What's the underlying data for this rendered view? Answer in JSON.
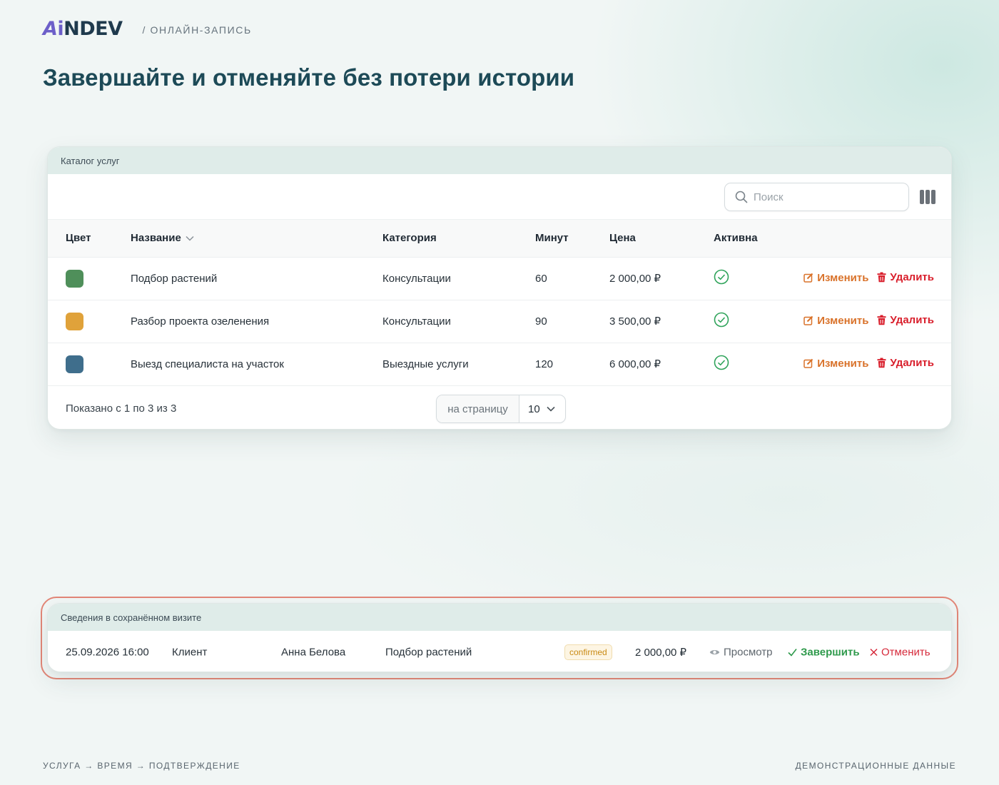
{
  "header": {
    "logo_a": "A",
    "logo_i": "i",
    "logo_rest": "NDEV",
    "crumb": "/ ОНЛАЙН-ЗАПИСЬ"
  },
  "page_title": "Завершайте и отменяйте без потери истории",
  "catalog": {
    "title": "Каталог услуг",
    "search_placeholder": "Поиск",
    "columns": {
      "color": "Цвет",
      "name": "Название",
      "category": "Категория",
      "minutes": "Минут",
      "price": "Цена",
      "active": "Активна"
    },
    "actions": {
      "edit": "Изменить",
      "delete": "Удалить"
    },
    "rows": [
      {
        "color": "#4f8f5a",
        "name": "Подбор растений",
        "category": "Консультации",
        "minutes": "60",
        "price": "2 000,00 ₽",
        "active": true
      },
      {
        "color": "#e0a23a",
        "name": "Разбор проекта озеленения",
        "category": "Консультации",
        "minutes": "90",
        "price": "3 500,00 ₽",
        "active": true
      },
      {
        "color": "#3f6e8c",
        "name": "Выезд специалиста на участок",
        "category": "Выездные услуги",
        "minutes": "120",
        "price": "6 000,00 ₽",
        "active": true
      }
    ],
    "footer": {
      "shown": "Показано с 1 по 3 из 3",
      "per_page_label": "на страницу",
      "per_page_value": "10"
    }
  },
  "visit": {
    "title": "Сведения в сохранённом визите",
    "datetime": "25.09.2026 16:00",
    "client_label": "Клиент",
    "client_name": "Анна Белова",
    "service": "Подбор растений",
    "status": "confirmed",
    "price": "2 000,00 ₽",
    "actions": {
      "view": "Просмотр",
      "complete": "Завершить",
      "cancel": "Отменить"
    }
  },
  "footer": {
    "left": "УСЛУГА → ВРЕМЯ → ПОДТВЕРЖДЕНИЕ",
    "right": "ДЕМОНСТРАЦИОННЫЕ ДАННЫЕ"
  },
  "colors": {
    "accent_logo": "#6d5fc9",
    "title": "#1d4a57",
    "edit": "#d9722a",
    "delete": "#d91f2c",
    "active_check": "#2fa35a",
    "highlight_outline": "#e28677"
  }
}
